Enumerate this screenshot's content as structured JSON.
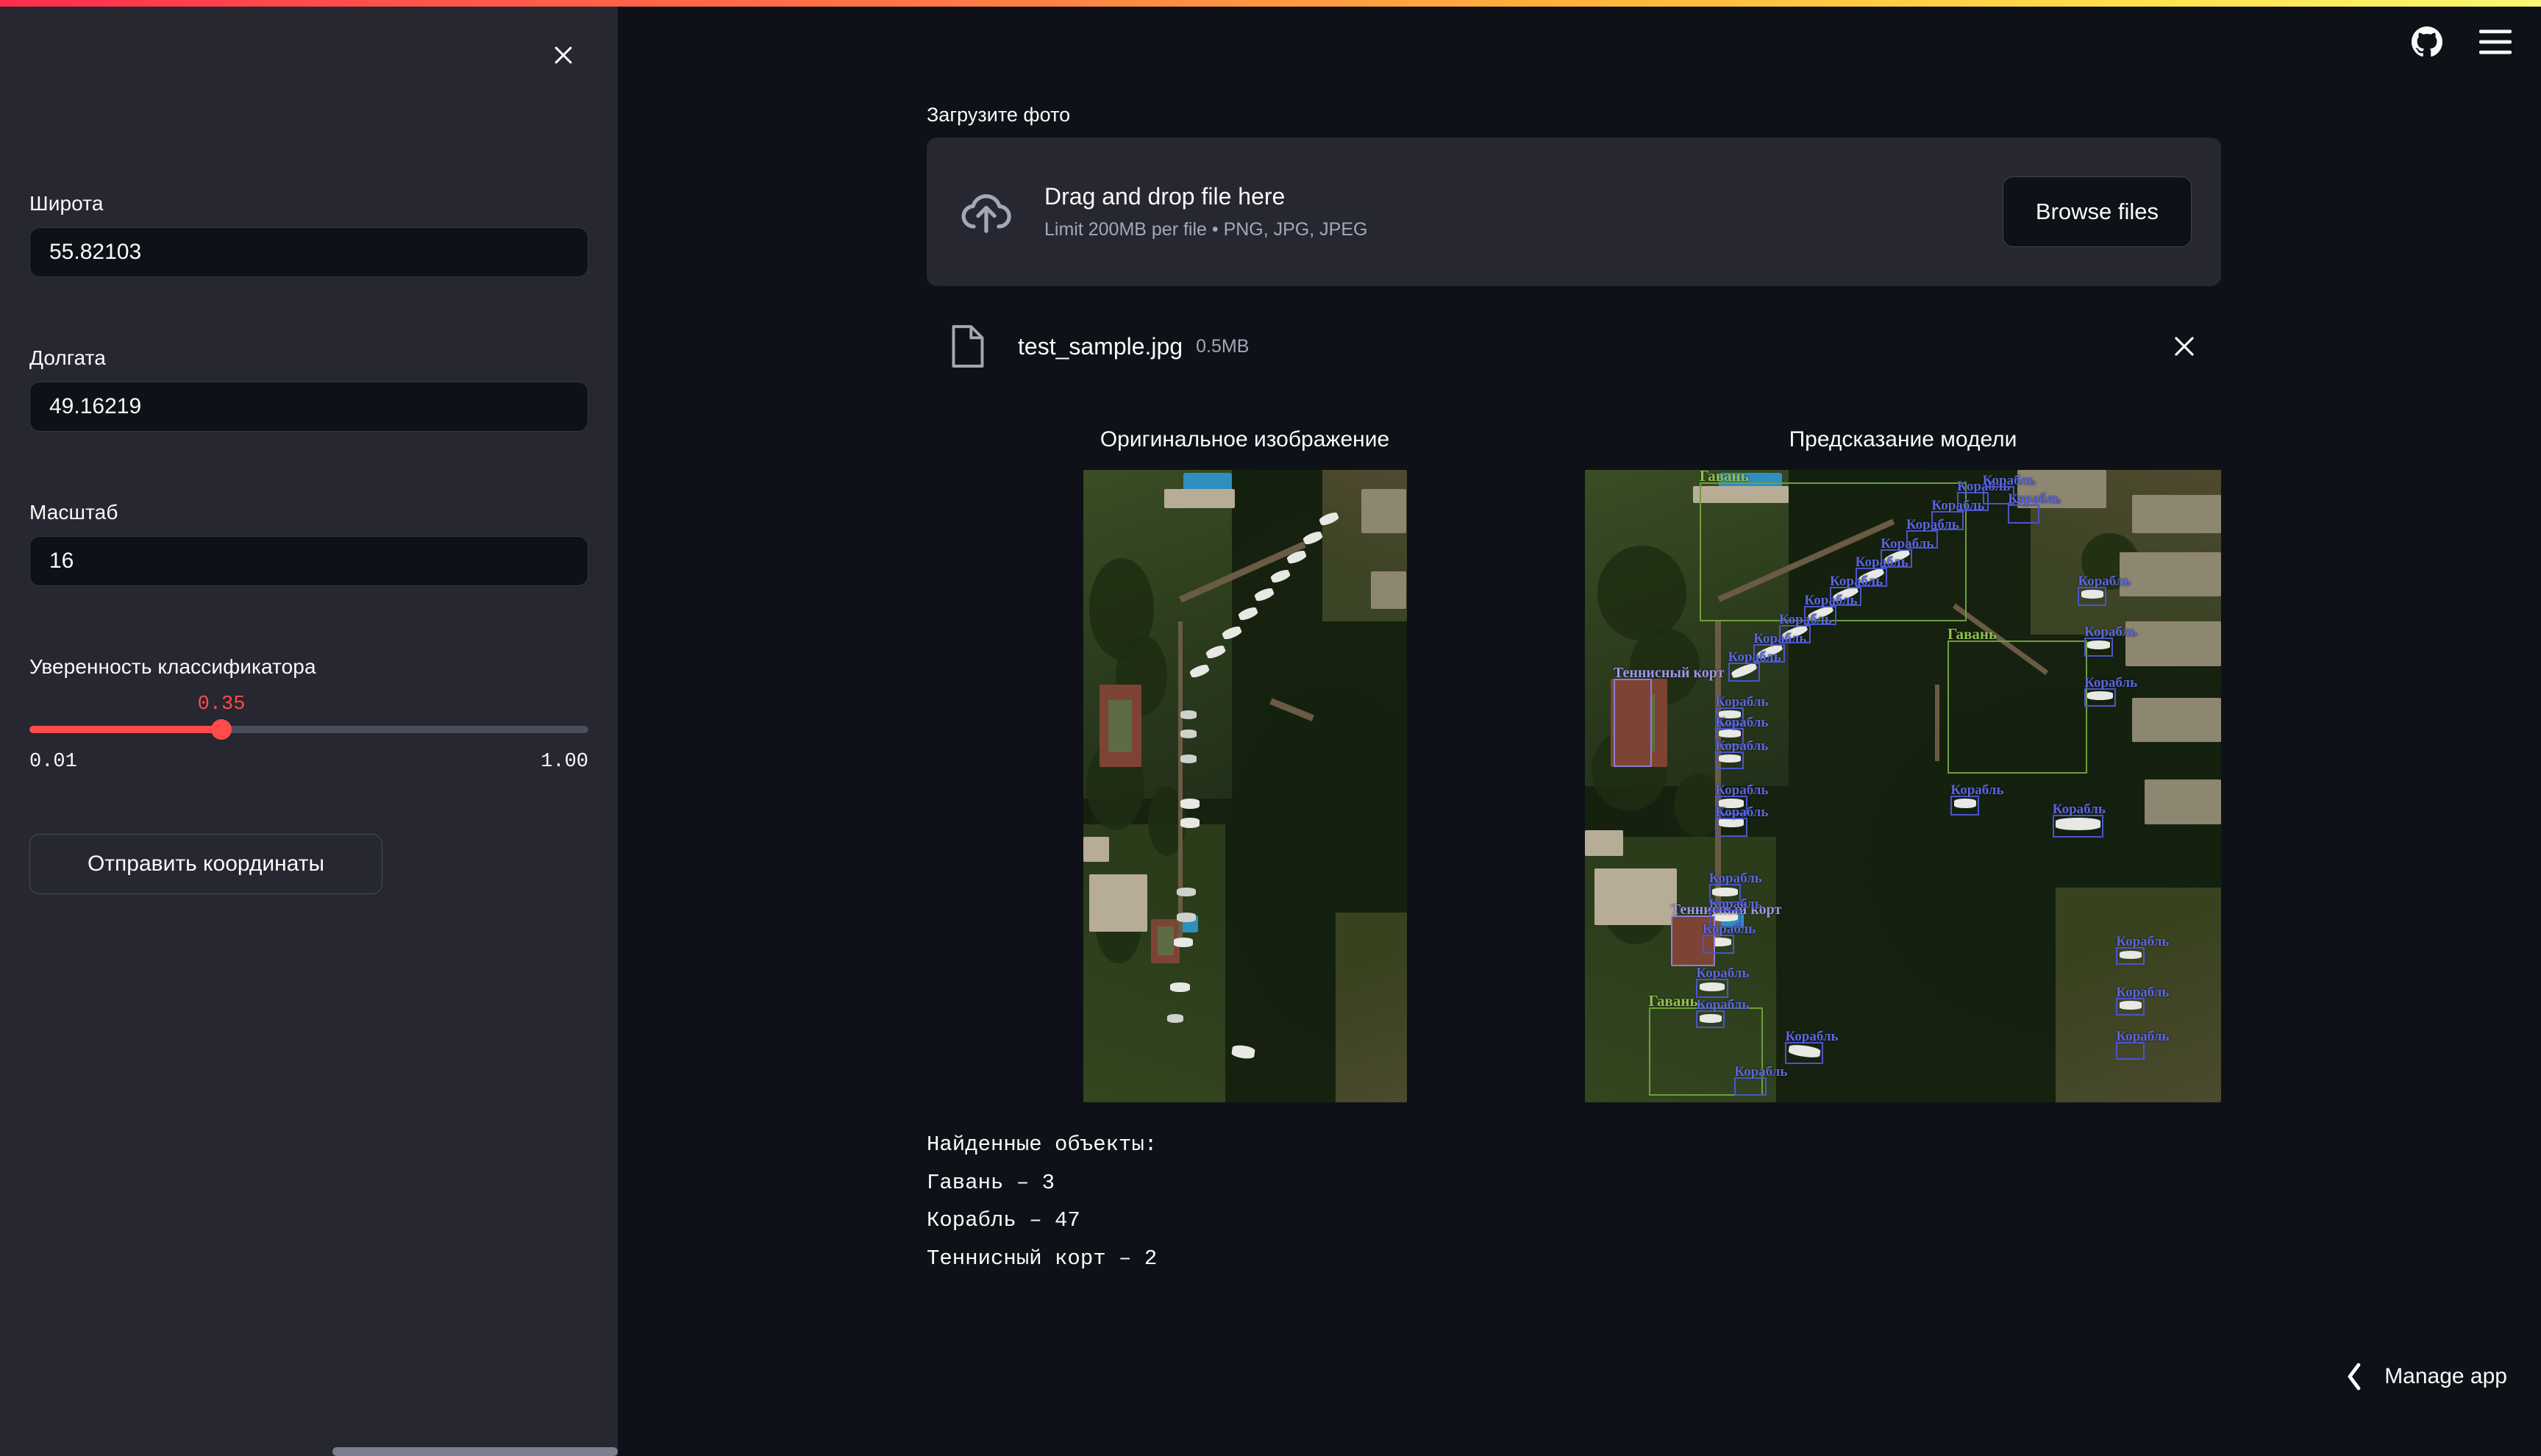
{
  "topbar": {
    "gradient_from": "#ff2b4e",
    "gradient_to": "#f9f871"
  },
  "header": {
    "github_icon": "github-icon",
    "menu_icon": "hamburger-menu-icon"
  },
  "sidebar": {
    "close_icon": "close-icon",
    "fields": [
      {
        "label": "Широта",
        "value": "55.82103"
      },
      {
        "label": "Долгата",
        "value": "49.16219"
      },
      {
        "label": "Масштаб",
        "value": "16"
      }
    ],
    "slider": {
      "label": "Уверенность классификатора",
      "value": "0.35",
      "value_num": 0.35,
      "min": "0.01",
      "max": "1.00",
      "min_num": 0.01,
      "max_num": 1.0,
      "fill_color": "#ff4b4b"
    },
    "submit_label": "Отправить координаты"
  },
  "main": {
    "upload_caption": "Загрузите фото",
    "dropzone": {
      "icon": "cloud-upload-icon",
      "title": "Drag and drop file here",
      "subtitle": "Limit 200MB per file • PNG, JPG, JPEG",
      "browse_label": "Browse files"
    },
    "uploaded_file": {
      "icon": "file-icon",
      "name": "test_sample.jpg",
      "size": "0.5MB",
      "remove_icon": "close-icon"
    },
    "images": {
      "original_caption": "Оригинальное изображение",
      "prediction_caption": "Предсказание модели"
    },
    "results": {
      "heading": "Найденные  объекты:",
      "lines": [
        "Гавань  –  3",
        "Корабль  –  47",
        "Теннисный  корт  –  2"
      ]
    }
  },
  "footer": {
    "manage_app_label": "Manage app",
    "chevron_icon": "chevron-left-icon"
  },
  "detections": {
    "classes": [
      {
        "name": "Гавань",
        "color": "#8fc24f",
        "count": 3
      },
      {
        "name": "Корабль",
        "color": "#5b66e0",
        "count": 47
      },
      {
        "name": "Теннисный корт",
        "color": "#9f95e8",
        "count": 2
      }
    ],
    "ship_label": "Корабль",
    "harbor_label": "Гавань",
    "court_label": "Теннисный корт"
  }
}
